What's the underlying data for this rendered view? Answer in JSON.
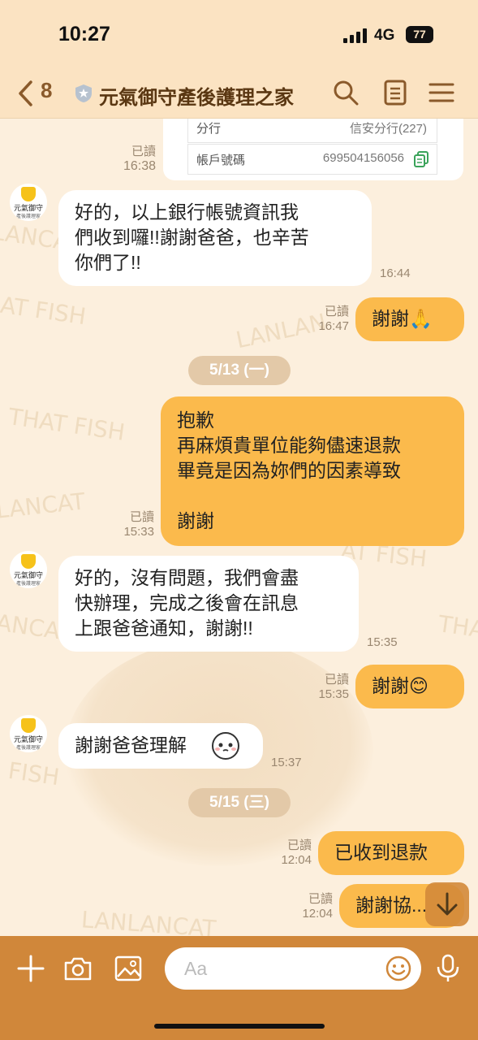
{
  "status_bar": {
    "time": "10:27",
    "network": "4G",
    "battery": "77"
  },
  "header": {
    "back_count": "8",
    "title": "元氣御守產後護理之家"
  },
  "bank_card": {
    "rows": [
      {
        "label": "分行",
        "value": "信安分行(227)"
      },
      {
        "label": "帳戶號碼",
        "value": "699504156056"
      }
    ]
  },
  "avatar": {
    "name": "元氣御守",
    "sub": "產後護理家"
  },
  "messages": [
    {
      "dir": "out",
      "read": "已讀",
      "time": "16:38"
    },
    {
      "dir": "in",
      "text": "好的，以上銀行帳號資訊我\n們收到囉!!謝謝爸爸，也辛苦\n你們了!!",
      "time": "16:44"
    },
    {
      "dir": "out",
      "text": "謝謝🙏",
      "read": "已讀",
      "time": "16:47"
    },
    {
      "dir": "out",
      "text": "抱歉\n再麻煩貴單位能夠儘速退款\n畢竟是因為妳們的因素導致\n\n謝謝",
      "read": "已讀",
      "time": "15:33"
    },
    {
      "dir": "in",
      "text": "好的，沒有問題，我們會盡\n快辦理，完成之後會在訊息\n上跟爸爸通知，謝謝!!",
      "time": "15:35"
    },
    {
      "dir": "out",
      "text": "謝謝😊",
      "read": "已讀",
      "time": "15:35"
    },
    {
      "dir": "in",
      "text": "謝謝爸爸理解",
      "time": "15:37"
    },
    {
      "dir": "out",
      "text": "已收到退款",
      "read": "已讀",
      "time": "12:04"
    },
    {
      "dir": "out",
      "text": "謝謝協...",
      "read": "已讀",
      "time": "12:04"
    }
  ],
  "dates": [
    "5/13 (一)",
    "5/15 (三)"
  ],
  "background_text": [
    "LANCAT",
    "AT FISH",
    "LANLAN",
    "THAT FISH",
    "LANCAT",
    "AT FISH",
    "ANCAT",
    "THAT",
    "FISH",
    "LANLANCAT"
  ],
  "composer": {
    "placeholder": "Aa"
  },
  "colors": {
    "header_bg": "#fbe3c2",
    "outgoing": "#fbba4c",
    "incoming": "#ffffff",
    "footer": "#d0873a",
    "title": "#5a3712"
  },
  "icons": [
    "chevron-left-icon",
    "shield-icon",
    "search-icon",
    "notes-icon",
    "menu-icon",
    "copy-icon",
    "plus-icon",
    "camera-icon",
    "image-icon",
    "emoji-icon",
    "mic-icon",
    "arrow-down-icon",
    "face-icon"
  ]
}
